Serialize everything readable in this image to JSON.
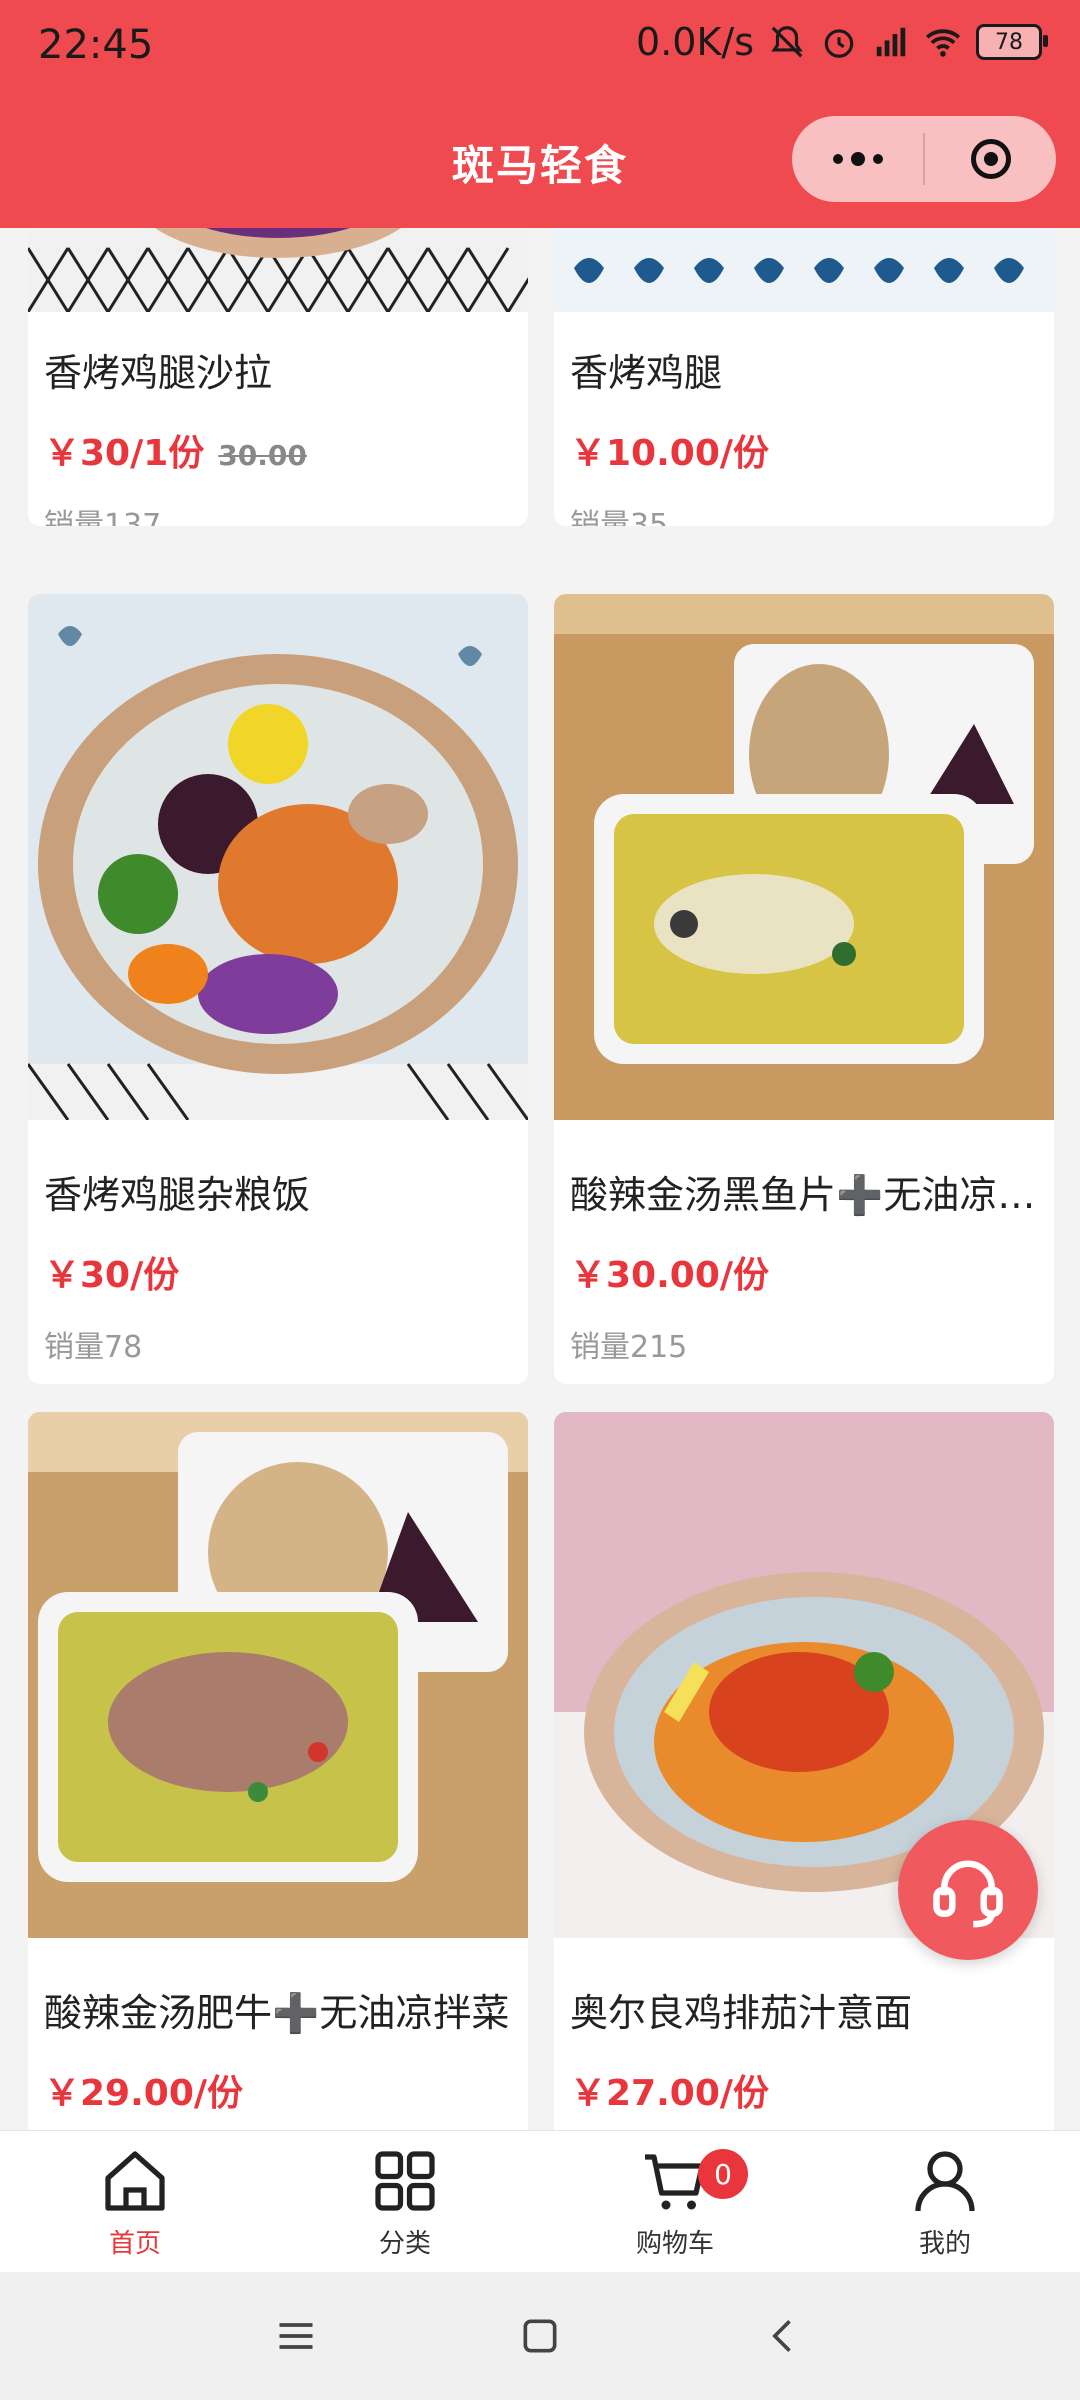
{
  "status_bar": {
    "time": "22:45",
    "net_speed": "0.0K/s",
    "battery": "78"
  },
  "nav": {
    "title": "斑马轻食"
  },
  "products": [
    {
      "title": "香烤鸡腿沙拉",
      "price": "￥30/1份",
      "original_price": "30.00",
      "sales": "销量137"
    },
    {
      "title": "香烤鸡腿",
      "price": "￥10.00/份",
      "sales": "销量35"
    },
    {
      "title": "香烤鸡腿杂粮饭",
      "price": "￥30/份",
      "sales": "销量78"
    },
    {
      "title": "酸辣金汤黑鱼片➕无油凉…",
      "price": "￥30.00/份",
      "sales": "销量215"
    },
    {
      "title": "酸辣金汤肥牛➕无油凉拌菜",
      "price": "￥29.00/份"
    },
    {
      "title": "奥尔良鸡排茄汁意面",
      "price": "￥27.00/份"
    }
  ],
  "tabbar": {
    "tabs": [
      {
        "label": "首页",
        "icon": "home-icon"
      },
      {
        "label": "分类",
        "icon": "grid-icon"
      },
      {
        "label": "购物车",
        "icon": "cart-icon"
      },
      {
        "label": "我的",
        "icon": "user-icon"
      }
    ],
    "cart_count": "0"
  },
  "colors": {
    "brand": "#ee4a4f",
    "price": "#e8363c"
  }
}
